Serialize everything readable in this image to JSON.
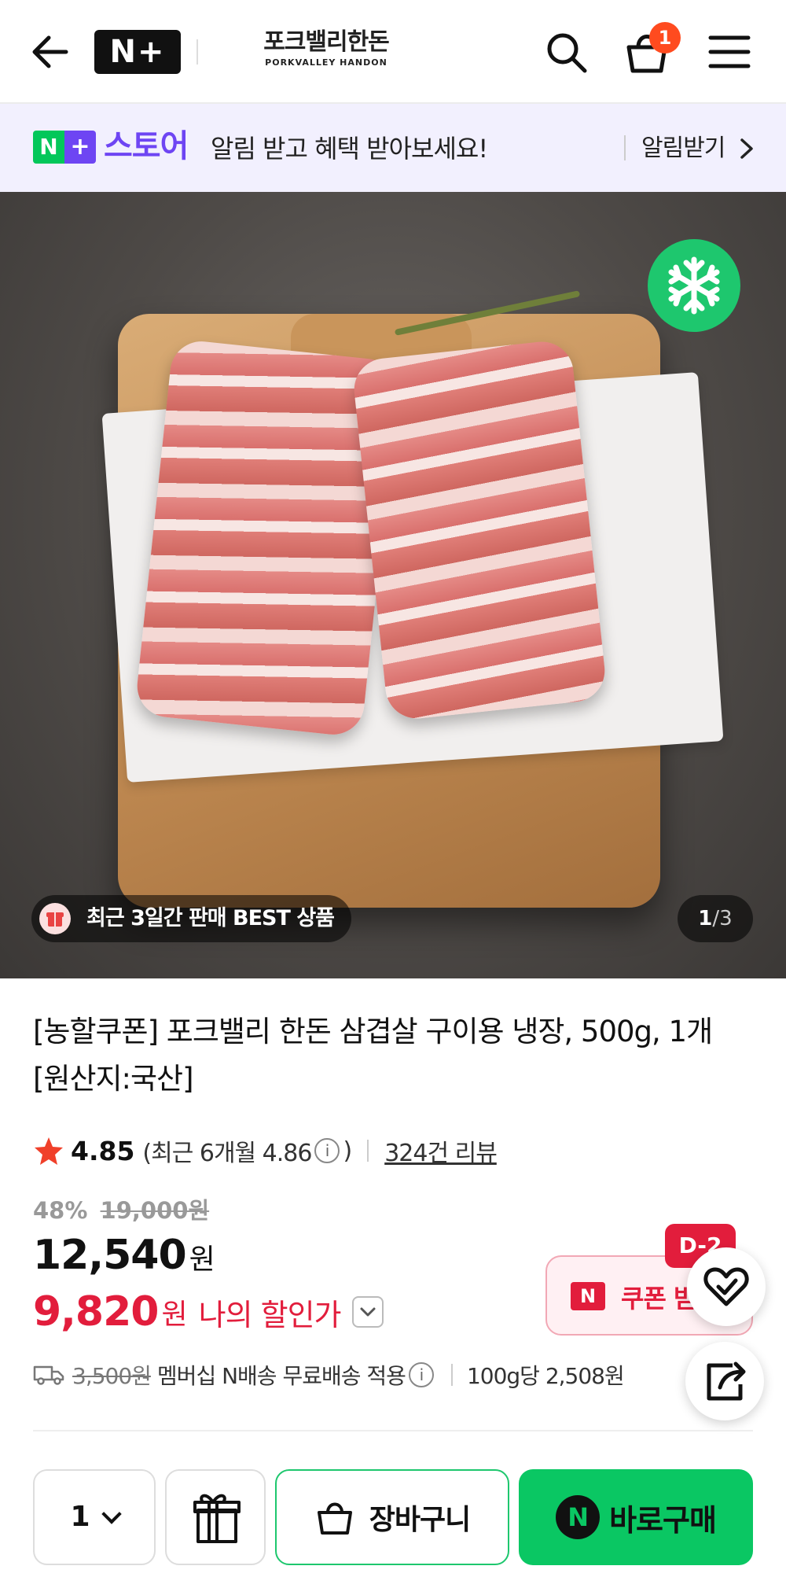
{
  "header": {
    "back_icon": "arrow-left-icon",
    "nplus_logo": "N+",
    "brand_name": "포크밸리한돈",
    "brand_sub": "PORKVALLEY HANDON",
    "cart_count": "1"
  },
  "banner": {
    "logo_n": "N",
    "logo_plus": "+",
    "store_word": "스토어",
    "message": "알림 받고 혜택 받아보세요!",
    "cta": "알림받기"
  },
  "hero": {
    "best_tag": "최근 3일간 판매 BEST 상품",
    "page_current": "1",
    "page_sep": "/",
    "page_total": "3"
  },
  "product": {
    "title": "[농할쿠폰] 포크밸리 한돈 삼겹살 구이용 냉장, 500g, 1개 [원산지:국산]",
    "rating": "4.85",
    "rating_recent": "(최근 6개월 4.86",
    "rating_recent_close": ")",
    "info_glyph": "i",
    "reviews": "324건 리뷰",
    "discount": "48%",
    "original_price": "19,000원",
    "price": "12,540",
    "won": "원",
    "my_price": "9,820",
    "my_price_label": "나의 할인가",
    "coupon_n": "N",
    "coupon_text": "쿠폰 받",
    "dday": "D-2",
    "ship_fee": "3,500원",
    "ship_text": "멤버십 N배송 무료배송 적용",
    "unit_price": "100g당 2,508원"
  },
  "bottom": {
    "qty": "1",
    "cart_label": "장바구니",
    "buy_n": "N",
    "buy_label": "바로구매"
  },
  "colors": {
    "naver_green": "#03c75a",
    "plus_purple": "#6e45f3",
    "sale_red": "#e21d3c",
    "badge_orange": "#ff4b1f"
  }
}
